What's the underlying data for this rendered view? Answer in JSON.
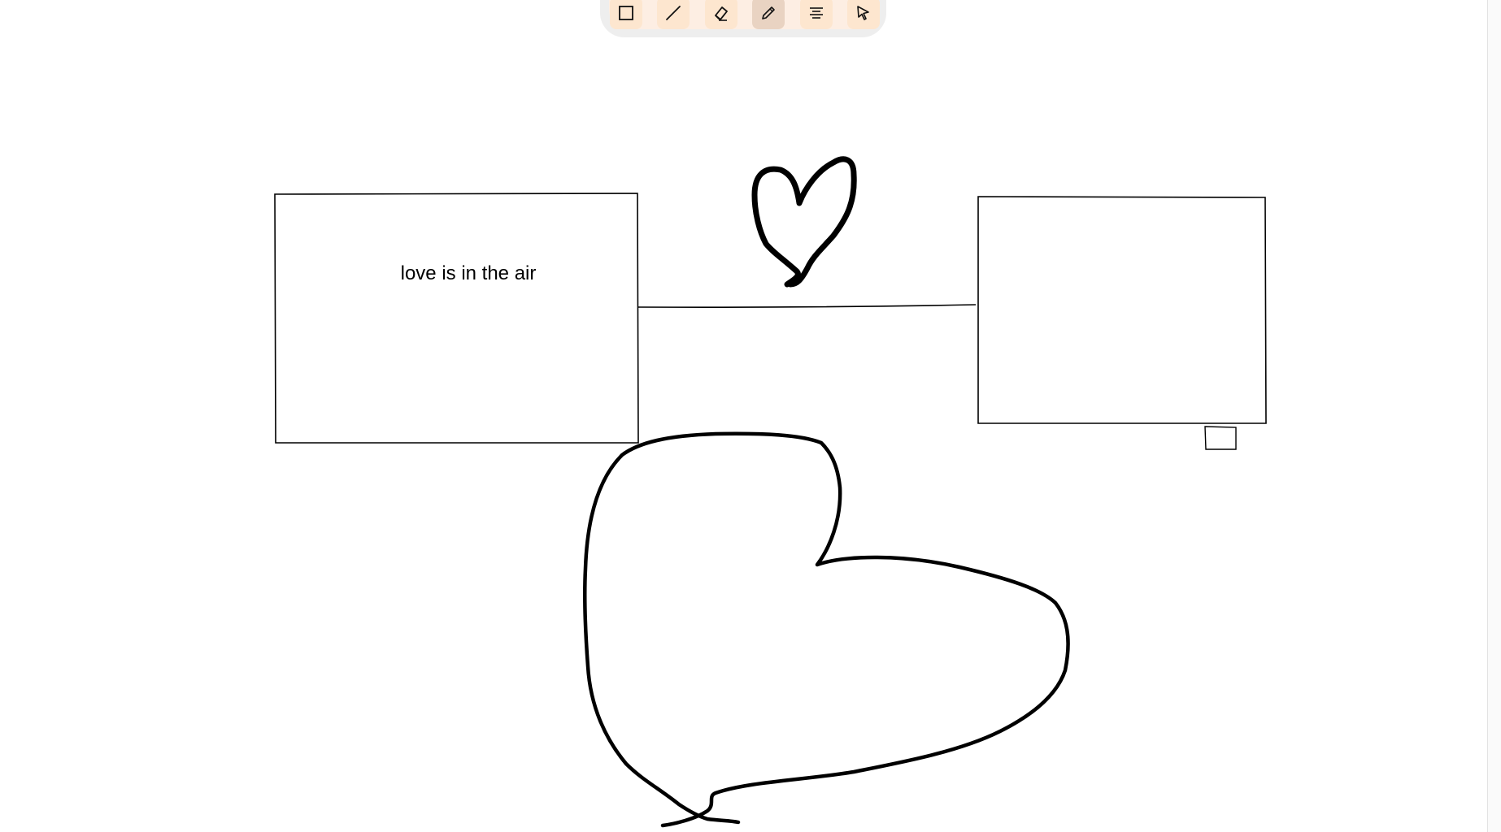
{
  "toolbar": {
    "tools": [
      {
        "name": "rectangle",
        "icon": "square-icon"
      },
      {
        "name": "line",
        "icon": "line-icon"
      },
      {
        "name": "eraser",
        "icon": "eraser-icon"
      },
      {
        "name": "pencil",
        "icon": "pencil-icon",
        "active": true
      },
      {
        "name": "text",
        "icon": "text-align-center-icon"
      },
      {
        "name": "select",
        "icon": "cursor-pointer-icon"
      }
    ],
    "colors": {
      "toolbar_bg": "#eeeeee",
      "tool_bg": "#fde6cf",
      "tool_active_bg": "#e9d3c2"
    }
  },
  "canvas": {
    "text_label": "love is in the air",
    "stroke_color": "#000000"
  }
}
